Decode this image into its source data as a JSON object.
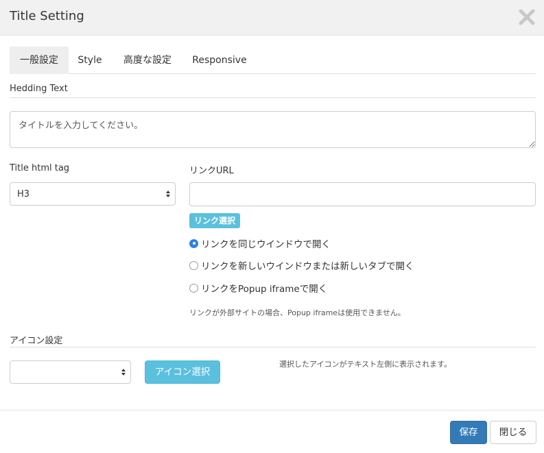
{
  "dialog": {
    "title": "Title Setting"
  },
  "tabs": [
    {
      "label": "一般設定",
      "active": true
    },
    {
      "label": "Style",
      "active": false
    },
    {
      "label": "高度な設定",
      "active": false
    },
    {
      "label": "Responsive",
      "active": false
    }
  ],
  "heading": {
    "section_label": "Hedding Text",
    "value": "タイトルを入力してください。"
  },
  "title_tag": {
    "label": "Title html tag",
    "selected": "H3"
  },
  "link": {
    "label": "リンクURL",
    "value": "",
    "select_button": "リンク選択",
    "options": [
      {
        "label": "リンクを同じウインドウで開く",
        "checked": true
      },
      {
        "label": "リンクを新しいウインドウまたは新しいタブで開く",
        "checked": false
      },
      {
        "label": "リンクをPopup iframeで開く",
        "checked": false
      }
    ],
    "note": "リンクが外部サイトの場合、Popup iframeは使用できません。"
  },
  "icon": {
    "section_label": "アイコン設定",
    "selected": "",
    "select_button": "アイコン選択",
    "note": "選択したアイコンがテキスト左側に表示されます。"
  },
  "footer": {
    "save_label": "保存",
    "close_label": "閉じる"
  },
  "colors": {
    "primary": "#337ab7",
    "info": "#5bc0de",
    "radio_checked": "#2f7fe8",
    "header_bg": "#f2f1f2"
  }
}
